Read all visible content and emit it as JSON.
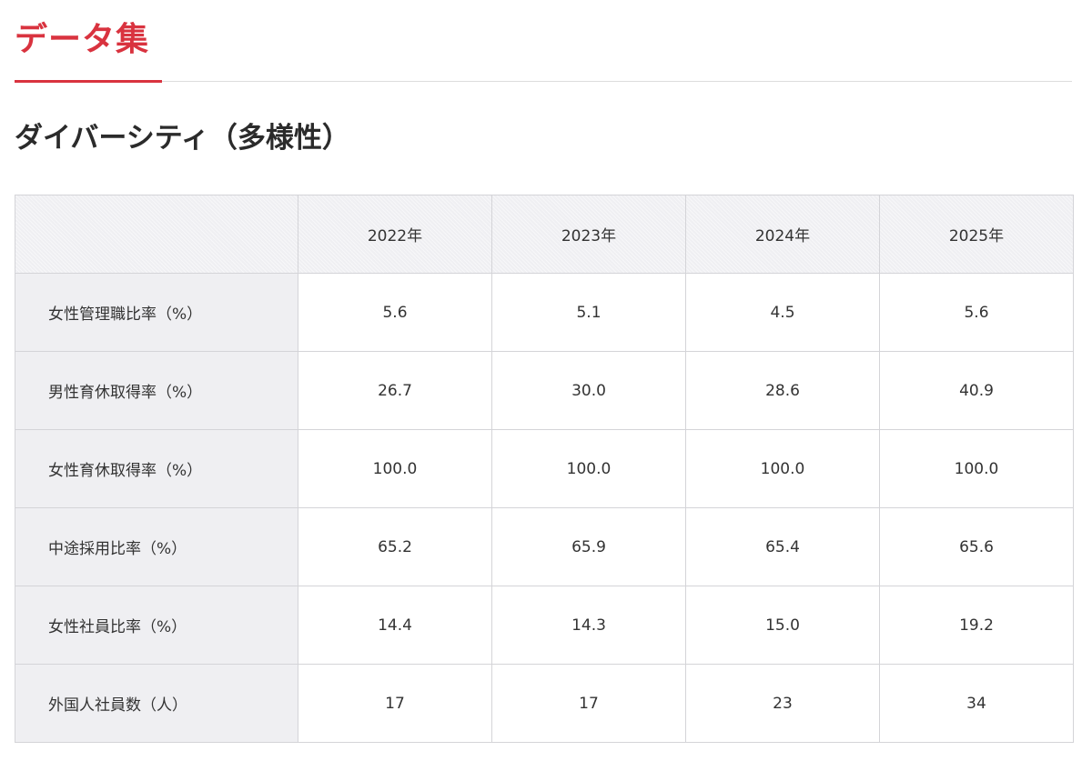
{
  "page": {
    "heading": "データ集",
    "accent_color": "#d9333f"
  },
  "section": {
    "title": "ダイバーシティ（多様性）"
  },
  "table": {
    "corner_label": "",
    "headers": [
      "2022年",
      "2023年",
      "2024年",
      "2025年"
    ],
    "rows": [
      {
        "label": "女性管理職比率（%）",
        "values": [
          "5.6",
          "5.1",
          "4.5",
          "5.6"
        ]
      },
      {
        "label": "男性育休取得率（%）",
        "values": [
          "26.7",
          "30.0",
          "28.6",
          "40.9"
        ]
      },
      {
        "label": "女性育休取得率（%）",
        "values": [
          "100.0",
          "100.0",
          "100.0",
          "100.0"
        ]
      },
      {
        "label": "中途採用比率（%）",
        "values": [
          "65.2",
          "65.9",
          "65.4",
          "65.6"
        ]
      },
      {
        "label": "女性社員比率（%）",
        "values": [
          "14.4",
          "14.3",
          "15.0",
          "19.2"
        ]
      },
      {
        "label": "外国人社員数（人）",
        "values": [
          "17",
          "17",
          "23",
          "34"
        ]
      }
    ]
  }
}
